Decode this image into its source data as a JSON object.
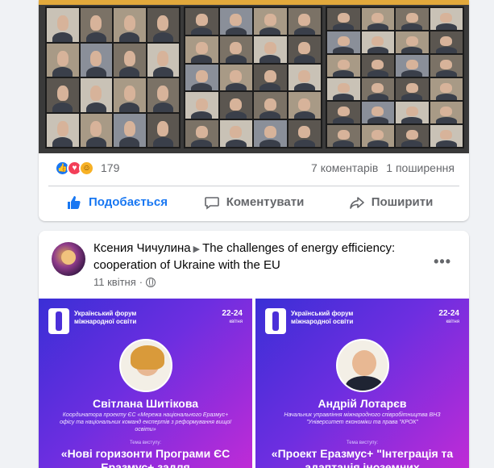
{
  "post1": {
    "reaction_count": "179",
    "comments": "7 коментарів",
    "shares": "1 поширення",
    "actions": {
      "like": "Подобається",
      "comment": "Коментувати",
      "share": "Поширити"
    }
  },
  "post2": {
    "author": "Ксения Чичулина",
    "group": "The challenges of energy efficiency: cooperation of Ukraine with the EU",
    "date": "11 квітня",
    "more": "•••",
    "banners": [
      {
        "forum": "Український форум міжнародної освіти",
        "dates": "22-24",
        "month": "квітня",
        "speaker": "Світлана Шитікова",
        "role": "Координатора проекту ЄС «Мережа національного Еразмус+ офісу та національних команд експертів з реформування вищої освіти»",
        "theme_label": "Тема виступу:",
        "talk": "«Нові горизонти Програми ЄС Еразмус+ задля"
      },
      {
        "forum": "Український форум міжнародної освіти",
        "dates": "22-24",
        "month": "квітня",
        "speaker": "Андрій Лотарєв",
        "role": "Начальник управління міжнародного співробітництва ВНЗ \"Університет економіки та права \"КРОК\"",
        "theme_label": "Тема виступу:",
        "talk": "«Проект Еразмус+ \"Інтеграція та адаптація іноземних"
      }
    ]
  },
  "colors": {
    "facebook_blue": "#1877f2",
    "banner_gradient_start": "#3a2fd6",
    "banner_gradient_end": "#c12bd6"
  }
}
